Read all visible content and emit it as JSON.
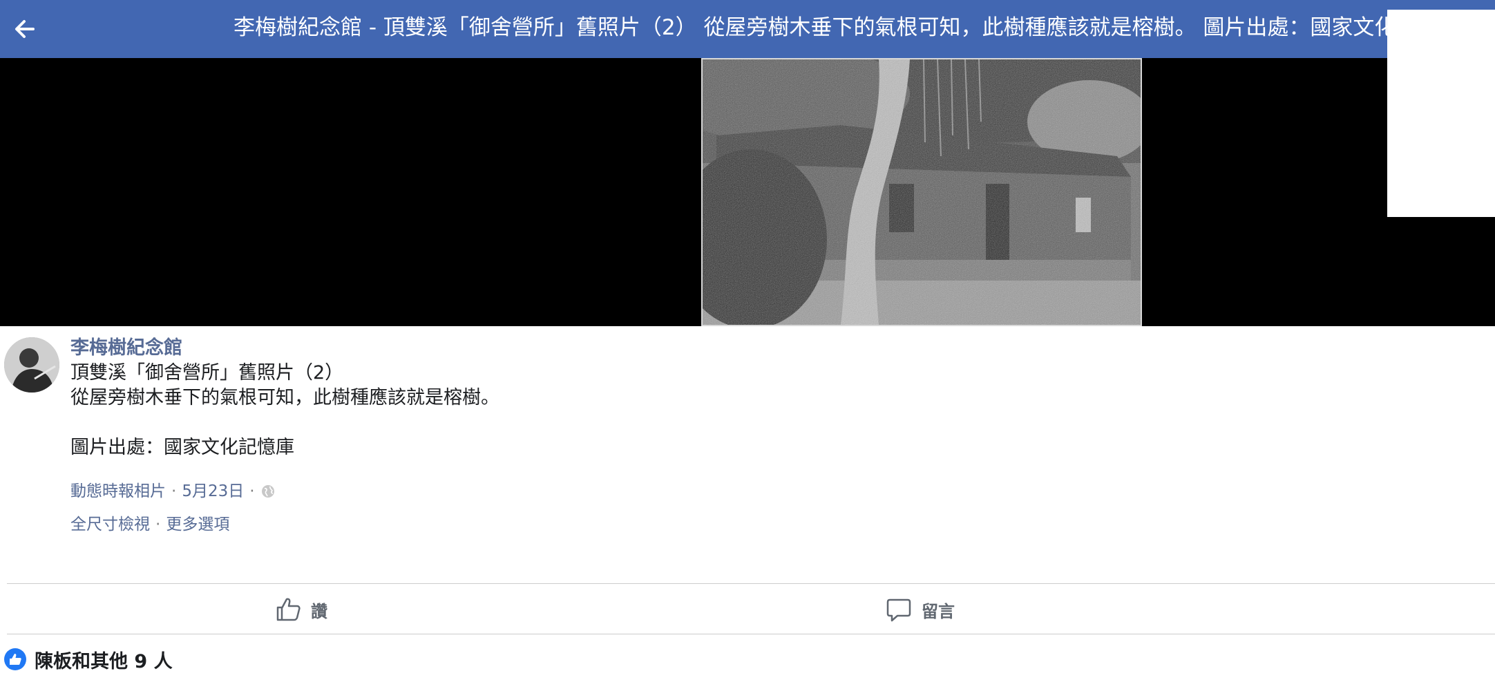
{
  "header": {
    "title": "李梅樹紀念館 - 頂雙溪「御舍營所」舊照片（2） 從屋旁樹木垂下的氣根可知，此樹種應該就是榕樹。 圖片出處：國家文化記憶庫",
    "back_icon": "arrow-left-icon"
  },
  "colors": {
    "header_bg": "#4267b2",
    "link": "#576b95",
    "like_blue": "#2078f4"
  },
  "post": {
    "author": "李梅樹紀念館",
    "lines": [
      "頂雙溪「御舍營所」舊照片（2）",
      "從屋旁樹木垂下的氣根可知，此樹種應該就是榕樹。",
      "",
      "圖片出處：國家文化記憶庫"
    ],
    "meta": {
      "album": "動態時報相片",
      "date": "5月23日",
      "privacy_icon": "globe-icon"
    },
    "options": {
      "full_size": "全尺寸檢視",
      "more": "更多選項"
    }
  },
  "actions": {
    "like": "讚",
    "comment": "留言"
  },
  "reactions": {
    "summary": "陳板和其他 9 人",
    "icon": "thumbs-up-badge-icon"
  }
}
